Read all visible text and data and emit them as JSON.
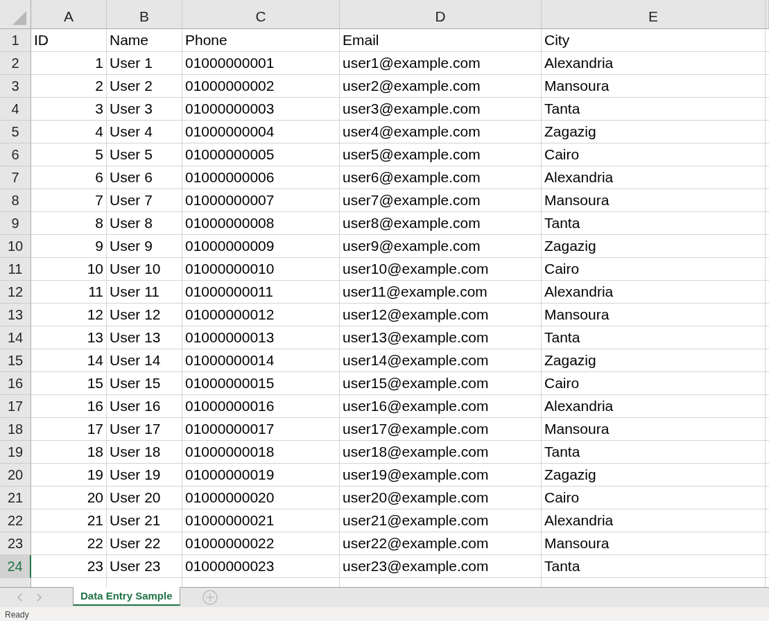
{
  "columns": [
    {
      "letter": "A",
      "kind": "number"
    },
    {
      "letter": "B",
      "kind": "text"
    },
    {
      "letter": "C",
      "kind": "text"
    },
    {
      "letter": "D",
      "kind": "text"
    },
    {
      "letter": "E",
      "kind": "text"
    }
  ],
  "rows": [
    {
      "number": "1",
      "selected": false,
      "kind": "labels",
      "cells": [
        "ID",
        "Name",
        "Phone",
        "Email",
        "City"
      ]
    },
    {
      "number": "2",
      "selected": false,
      "kind": "record",
      "cells": [
        "1",
        "User 1",
        "01000000001",
        "user1@example.com",
        "Alexandria"
      ]
    },
    {
      "number": "3",
      "selected": false,
      "kind": "record",
      "cells": [
        "2",
        "User 2",
        "01000000002",
        "user2@example.com",
        "Mansoura"
      ]
    },
    {
      "number": "4",
      "selected": false,
      "kind": "record",
      "cells": [
        "3",
        "User 3",
        "01000000003",
        "user3@example.com",
        "Tanta"
      ]
    },
    {
      "number": "5",
      "selected": false,
      "kind": "record",
      "cells": [
        "4",
        "User 4",
        "01000000004",
        "user4@example.com",
        "Zagazig"
      ]
    },
    {
      "number": "6",
      "selected": false,
      "kind": "record",
      "cells": [
        "5",
        "User 5",
        "01000000005",
        "user5@example.com",
        "Cairo"
      ]
    },
    {
      "number": "7",
      "selected": false,
      "kind": "record",
      "cells": [
        "6",
        "User 6",
        "01000000006",
        "user6@example.com",
        "Alexandria"
      ]
    },
    {
      "number": "8",
      "selected": false,
      "kind": "record",
      "cells": [
        "7",
        "User 7",
        "01000000007",
        "user7@example.com",
        "Mansoura"
      ]
    },
    {
      "number": "9",
      "selected": false,
      "kind": "record",
      "cells": [
        "8",
        "User 8",
        "01000000008",
        "user8@example.com",
        "Tanta"
      ]
    },
    {
      "number": "10",
      "selected": false,
      "kind": "record",
      "cells": [
        "9",
        "User 9",
        "01000000009",
        "user9@example.com",
        "Zagazig"
      ]
    },
    {
      "number": "11",
      "selected": false,
      "kind": "record",
      "cells": [
        "10",
        "User 10",
        "01000000010",
        "user10@example.com",
        "Cairo"
      ]
    },
    {
      "number": "12",
      "selected": false,
      "kind": "record",
      "cells": [
        "11",
        "User 11",
        "01000000011",
        "user11@example.com",
        "Alexandria"
      ]
    },
    {
      "number": "13",
      "selected": false,
      "kind": "record",
      "cells": [
        "12",
        "User 12",
        "01000000012",
        "user12@example.com",
        "Mansoura"
      ]
    },
    {
      "number": "14",
      "selected": false,
      "kind": "record",
      "cells": [
        "13",
        "User 13",
        "01000000013",
        "user13@example.com",
        "Tanta"
      ]
    },
    {
      "number": "15",
      "selected": false,
      "kind": "record",
      "cells": [
        "14",
        "User 14",
        "01000000014",
        "user14@example.com",
        "Zagazig"
      ]
    },
    {
      "number": "16",
      "selected": false,
      "kind": "record",
      "cells": [
        "15",
        "User 15",
        "01000000015",
        "user15@example.com",
        "Cairo"
      ]
    },
    {
      "number": "17",
      "selected": false,
      "kind": "record",
      "cells": [
        "16",
        "User 16",
        "01000000016",
        "user16@example.com",
        "Alexandria"
      ]
    },
    {
      "number": "18",
      "selected": false,
      "kind": "record",
      "cells": [
        "17",
        "User 17",
        "01000000017",
        "user17@example.com",
        "Mansoura"
      ]
    },
    {
      "number": "19",
      "selected": false,
      "kind": "record",
      "cells": [
        "18",
        "User 18",
        "01000000018",
        "user18@example.com",
        "Tanta"
      ]
    },
    {
      "number": "20",
      "selected": false,
      "kind": "record",
      "cells": [
        "19",
        "User 19",
        "01000000019",
        "user19@example.com",
        "Zagazig"
      ]
    },
    {
      "number": "21",
      "selected": false,
      "kind": "record",
      "cells": [
        "20",
        "User 20",
        "01000000020",
        "user20@example.com",
        "Cairo"
      ]
    },
    {
      "number": "22",
      "selected": false,
      "kind": "record",
      "cells": [
        "21",
        "User 21",
        "01000000021",
        "user21@example.com",
        "Alexandria"
      ]
    },
    {
      "number": "23",
      "selected": false,
      "kind": "record",
      "cells": [
        "22",
        "User 22",
        "01000000022",
        "user22@example.com",
        "Mansoura"
      ]
    },
    {
      "number": "24",
      "selected": true,
      "kind": "record",
      "cells": [
        "23",
        "User 23",
        "01000000023",
        "user23@example.com",
        "Tanta"
      ]
    }
  ],
  "sheet_tabs": [
    {
      "label": "Data Entry Sample",
      "selected": true
    }
  ],
  "status_bar": {
    "text": "Ready"
  }
}
